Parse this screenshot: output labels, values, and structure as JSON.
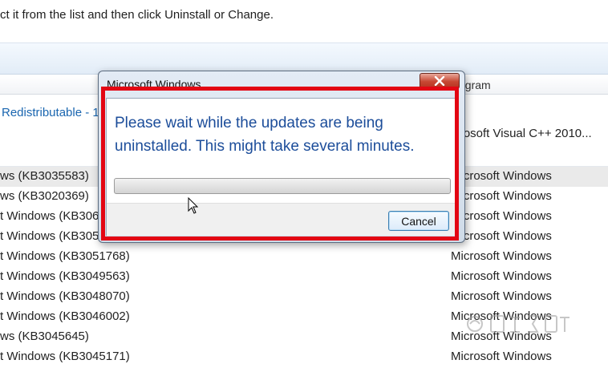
{
  "instruction": "ct it from the list and then click Uninstall or Change.",
  "column_header": {
    "program": "ogram"
  },
  "group": {
    "name": "Redistributable - 1",
    "publisher": "icrosoft Visual C++ 2010..."
  },
  "rows": [
    {
      "name": "ws (KB3035583)",
      "publisher": "Microsoft Windows",
      "selected": true
    },
    {
      "name": "ws (KB3020369)",
      "publisher": "Microsoft Windows"
    },
    {
      "name": "t Windows (KB306",
      "publisher": "Microsoft Windows"
    },
    {
      "name": "t Windows (KB305",
      "publisher": "Microsoft Windows"
    },
    {
      "name": "t Windows (KB3051768)",
      "publisher": "Microsoft Windows"
    },
    {
      "name": "t Windows (KB3049563)",
      "publisher": "Microsoft Windows"
    },
    {
      "name": "t Windows (KB3048070)",
      "publisher": "Microsoft Windows"
    },
    {
      "name": "t Windows (KB3046002)",
      "publisher": "Microsoft Windows"
    },
    {
      "name": "ws (KB3045645)",
      "publisher": "Microsoft Windows"
    },
    {
      "name": "t Windows (KB3045171)",
      "publisher": "Microsoft Windows"
    }
  ],
  "dialog": {
    "title": "Microsoft Windows",
    "message": "Please wait while the updates are being uninstalled. This might take several minutes.",
    "progress": 0,
    "cancel_label": "Cancel",
    "close_icon": "close-icon"
  },
  "highlight_color": "#e30613",
  "watermark_icon": "baidu-jingyan-watermark-icon"
}
